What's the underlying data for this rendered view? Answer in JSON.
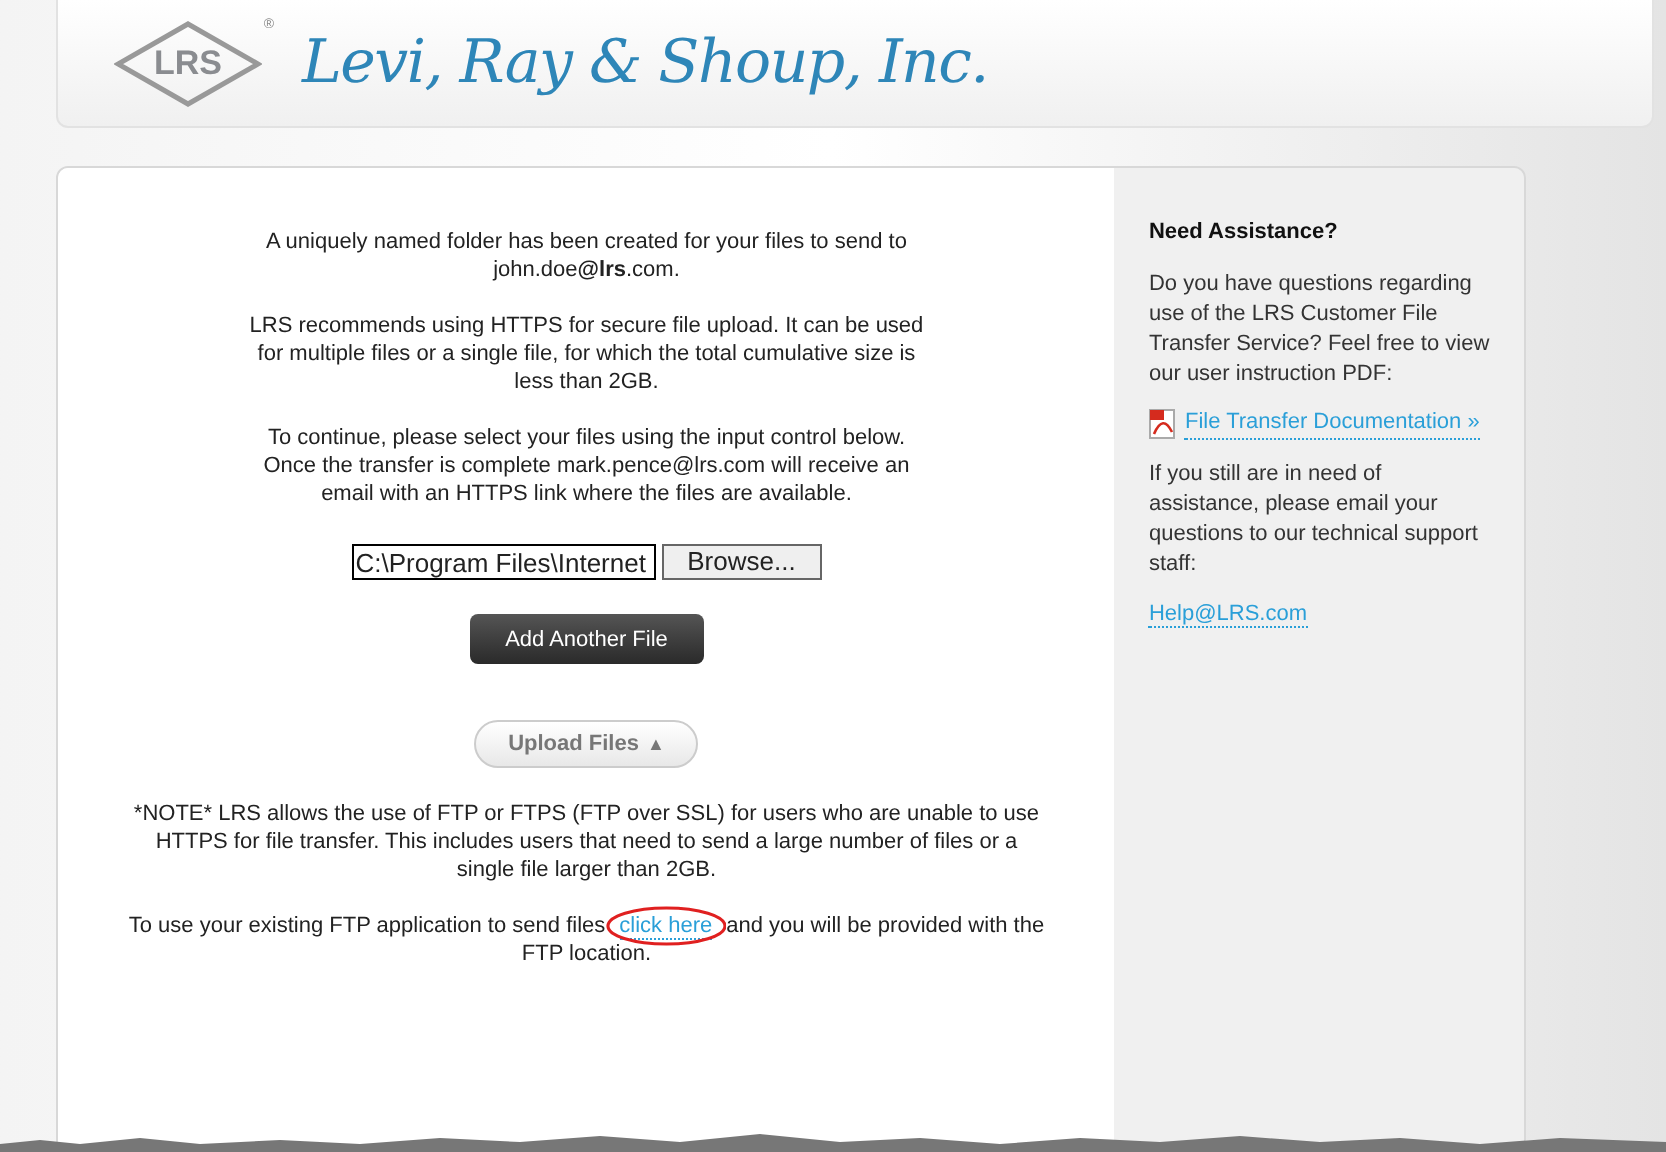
{
  "header": {
    "logo_mark": "LRS",
    "logo_registered": "®",
    "company_name": "Levi, Ray & Shoup, Inc."
  },
  "main": {
    "paragraphs": [
      "A uniquely named folder has been created for your files to send to john.doe**@lrs**.com.",
      "LRS recommends using HTTPS for secure file upload. It can be used for multiple files or a single file, for which the total cumulative size is less than 2GB.",
      "To continue, please select your files using the input control below. Once the transfer is complete mark.pence@lrs.com will receive an email with an HTTPS link where the files are available."
    ],
    "file_input": {
      "value": "C:\\Program Files\\Internet",
      "browse_label": "Browse..."
    },
    "add_button": "Add Another File",
    "upload_button": {
      "label": "Upload Files",
      "arrow": "▲"
    },
    "note": "*NOTE* LRS allows the use of FTP or FTPS (FTP over SSL) for users who are unable to use HTTPS for file transfer. This includes users that need to send a large number of files or a single file larger than 2GB.",
    "ftp": {
      "before": "To use your existing FTP application to send files",
      "link": "click here",
      "after": "and you will be provided with the FTP location."
    }
  },
  "sidebar": {
    "title": "Need Assistance?",
    "intro": "Do you have questions regarding use of the LRS Customer File Transfer Service? Feel free to view our user instruction PDF:",
    "doc_link": "File Transfer Documentation »",
    "help_text": "If you still are in need of assistance, please email your questions to our technical support staff:",
    "email_link": "Help@LRS.com"
  }
}
